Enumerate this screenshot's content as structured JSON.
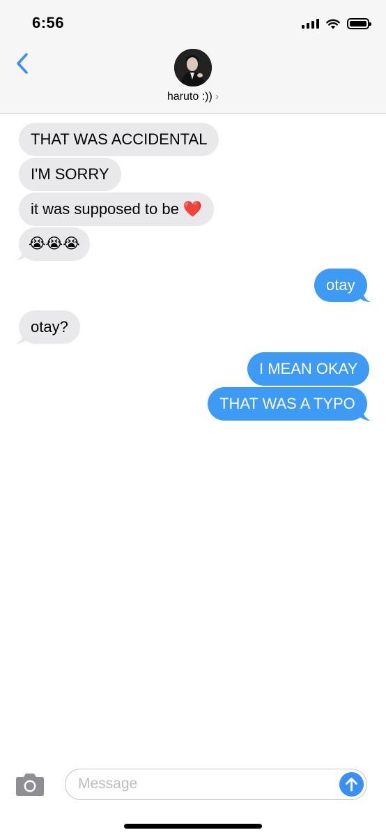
{
  "status_bar": {
    "time": "6:56"
  },
  "header": {
    "contact_name": "haruto :))",
    "chevron": "›"
  },
  "messages": [
    {
      "direction": "incoming",
      "text": "THAT WAS ACCIDENTAL"
    },
    {
      "direction": "incoming",
      "text": "I'M SORRY"
    },
    {
      "direction": "incoming",
      "text": "it was supposed to be ❤️"
    },
    {
      "direction": "incoming",
      "text": "😭😭😭"
    },
    {
      "direction": "outgoing",
      "text": "otay"
    },
    {
      "direction": "incoming",
      "text": "otay?"
    },
    {
      "direction": "outgoing",
      "text": "I MEAN OKAY"
    },
    {
      "direction": "outgoing",
      "text": "THAT WAS A TYPO"
    }
  ],
  "composer": {
    "placeholder": "Message",
    "value": ""
  },
  "icons": {
    "back": "chevron-left-icon",
    "camera": "camera-icon",
    "send": "arrow-up-icon",
    "signal": "cellular-signal-icon",
    "wifi": "wifi-icon",
    "battery": "battery-icon"
  },
  "colors": {
    "incoming_bubble": "#e9e9eb",
    "outgoing_bubble": "#3e9bf5",
    "accent": "#3a8ff2",
    "header_bg": "#f6f6f6"
  }
}
